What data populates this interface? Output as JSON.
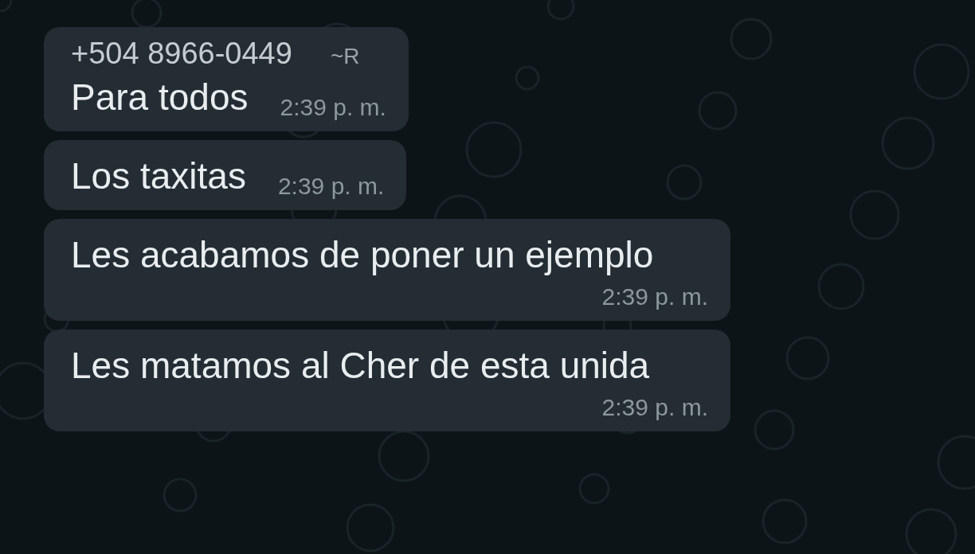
{
  "messages": [
    {
      "sender": "+504 8966-0449",
      "sender_name": "~R",
      "text": "Para todos",
      "time": "2:39 p. m."
    },
    {
      "text": "Los taxitas",
      "time": "2:39 p. m."
    },
    {
      "text": "Les acabamos de poner un ejemplo",
      "time": "2:39 p. m."
    },
    {
      "text": "Les matamos al Cher de esta unida",
      "time": "2:39 p. m."
    }
  ]
}
